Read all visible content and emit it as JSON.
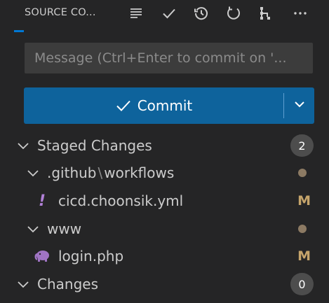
{
  "header": {
    "title": "SOURCE CO...",
    "icons": [
      "list-icon",
      "check-icon",
      "history-icon",
      "refresh-icon",
      "graph-icon",
      "more-icon"
    ]
  },
  "message": {
    "placeholder": "Message (Ctrl+Enter to commit on '..."
  },
  "commit": {
    "label": "Commit"
  },
  "staged": {
    "label": "Staged Changes",
    "count": "2",
    "folders": [
      {
        "part1": ".github",
        "sep": "\\",
        "part2": "workflows",
        "files": [
          {
            "name": "cicd.choonsik.yml",
            "status": "M",
            "icon": "exclamation-icon"
          }
        ]
      },
      {
        "name": "www",
        "files": [
          {
            "name": "login.php",
            "status": "M",
            "icon": "elephant-icon"
          }
        ]
      }
    ]
  },
  "changes": {
    "label": "Changes",
    "count": "0"
  },
  "colors": {
    "accent": "#0e639c",
    "modified": "#c5a46b",
    "folder_dot": "#8c7a63"
  }
}
